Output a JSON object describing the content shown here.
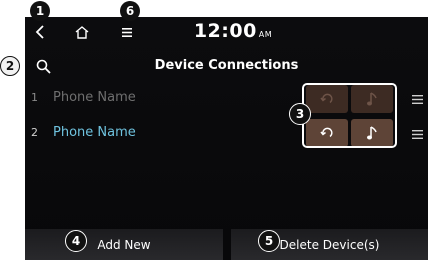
{
  "status_bar": {
    "time": "12:00",
    "ampm": "AM",
    "back_icon": "back-arrow-icon",
    "home_icon": "home-icon",
    "menu_icon": "menu-icon"
  },
  "header": {
    "title": "Device Connections",
    "search_icon": "search-icon"
  },
  "devices": [
    {
      "number": "1",
      "name": "Phone Name",
      "connected": false,
      "phone_profile_on": false,
      "audio_profile_on": false
    },
    {
      "number": "2",
      "name": "Phone Name",
      "connected": true,
      "phone_profile_on": true,
      "audio_profile_on": true
    }
  ],
  "footer": {
    "add_label": "Add New",
    "delete_label": "Delete Device(s)"
  },
  "callouts": [
    "1",
    "2",
    "3",
    "4",
    "5",
    "6"
  ],
  "colors": {
    "connected_name": "#6fc3df",
    "inactive_name": "#6f6f6f",
    "profile_active_bg": "#5e4437",
    "profile_inactive_bg": "#3d2b23"
  }
}
